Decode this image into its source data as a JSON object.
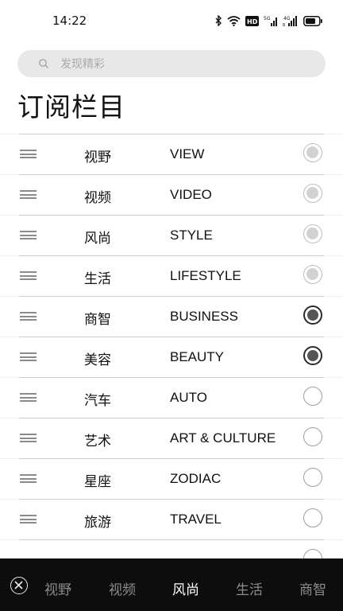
{
  "status": {
    "time": "14:22"
  },
  "search": {
    "placeholder": "发现精彩"
  },
  "page": {
    "title": "订阅栏目"
  },
  "columns": [
    {
      "zh": "视野",
      "en": "VIEW",
      "state": "disabled"
    },
    {
      "zh": "视频",
      "en": "VIDEO",
      "state": "disabled"
    },
    {
      "zh": "风尚",
      "en": "STYLE",
      "state": "disabled"
    },
    {
      "zh": "生活",
      "en": "LIFESTYLE",
      "state": "disabled"
    },
    {
      "zh": "商智",
      "en": "BUSINESS",
      "state": "checked"
    },
    {
      "zh": "美容",
      "en": "BEAUTY",
      "state": "checked"
    },
    {
      "zh": "汽车",
      "en": "AUTO",
      "state": "off"
    },
    {
      "zh": "艺术",
      "en": "ART & CULTURE",
      "state": "off"
    },
    {
      "zh": "星座",
      "en": "ZODIAC",
      "state": "off"
    },
    {
      "zh": "旅游",
      "en": "TRAVEL",
      "state": "off"
    }
  ],
  "bottom_tabs": [
    {
      "label": "视野",
      "active": false
    },
    {
      "label": "视频",
      "active": false
    },
    {
      "label": "风尚",
      "active": true
    },
    {
      "label": "生活",
      "active": false
    },
    {
      "label": "商智",
      "active": false
    }
  ],
  "icons": {
    "bluetooth": "bluetooth-icon",
    "wifi": "wifi-icon",
    "hd": "hd-icon",
    "signal_5g": "signal-5g-icon",
    "signal_4g": "signal-4g-icon",
    "battery": "battery-icon",
    "search": "search-icon",
    "close": "close-icon",
    "drag": "drag-handle-icon"
  }
}
